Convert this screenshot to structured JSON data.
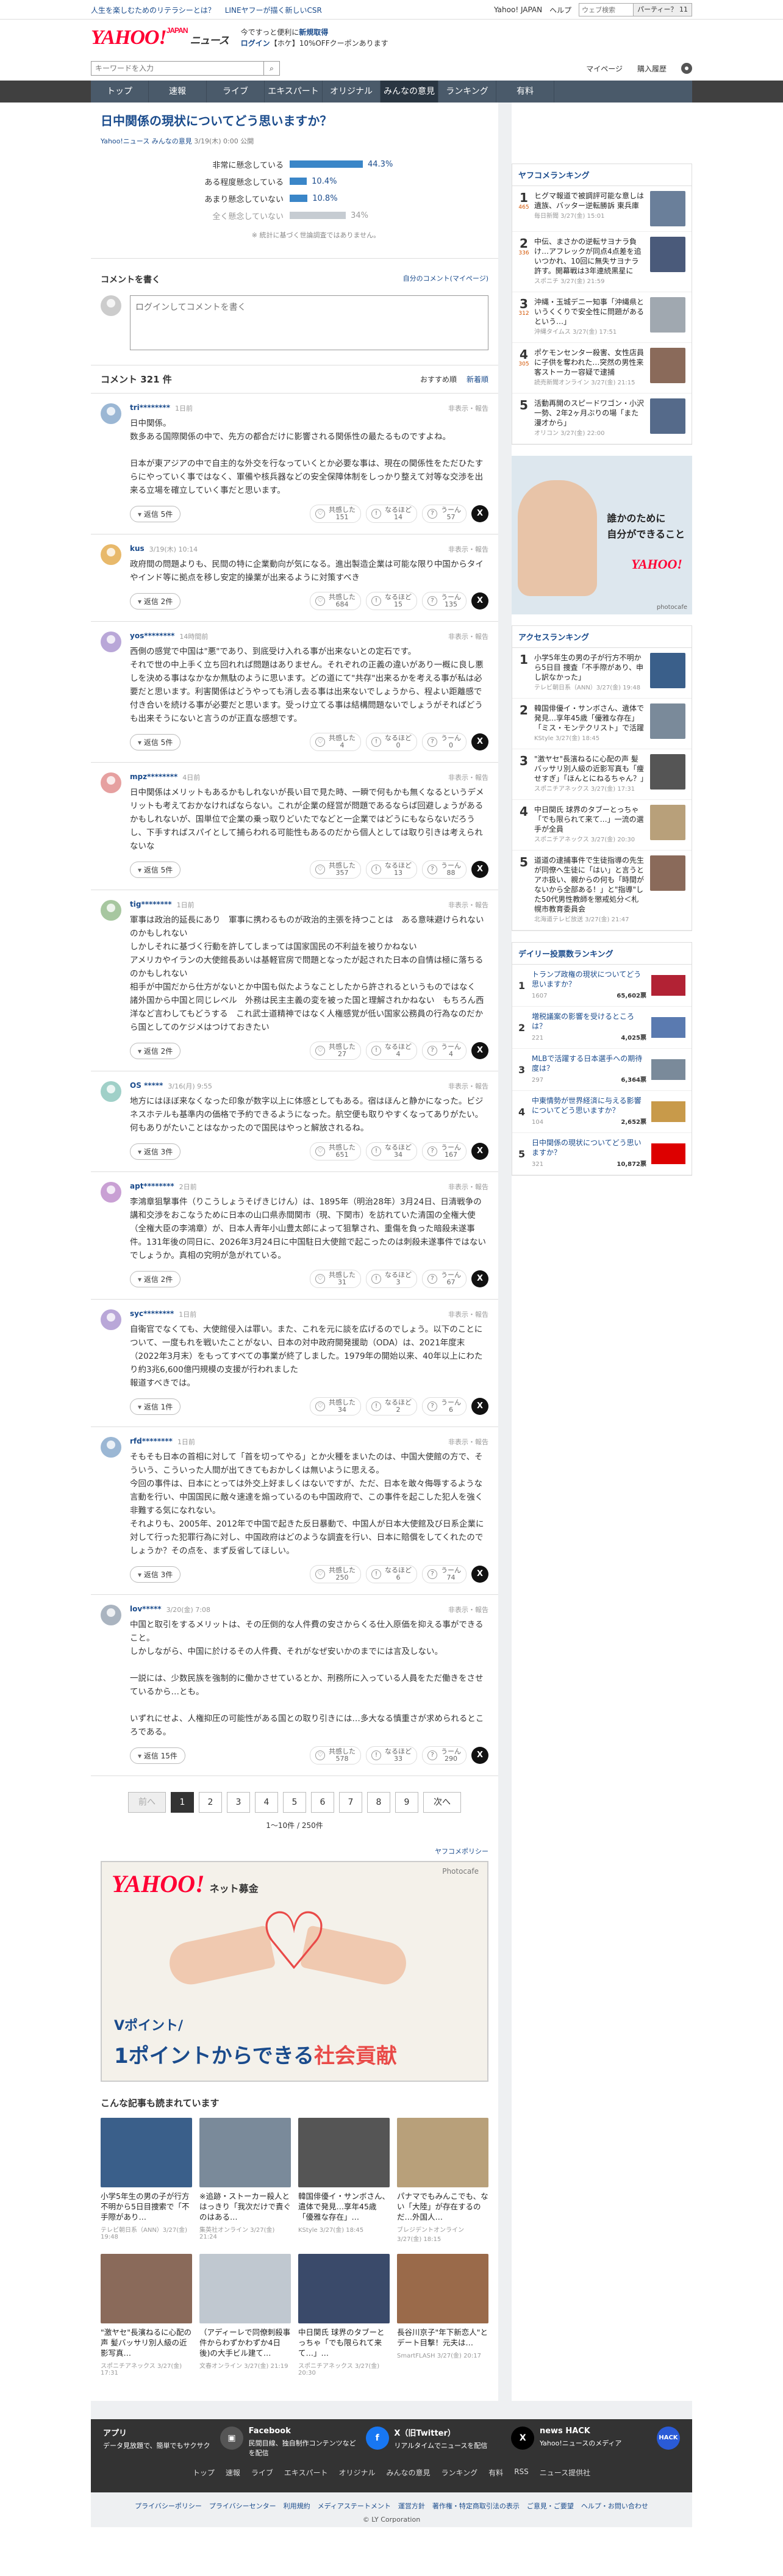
{
  "topbar": {
    "left1": "人生を楽しむためのリテラシーとは？",
    "left2": "LINEヤフーが描く新しいCSR",
    "right1": "Yahoo! JAPAN",
    "right2": "ヘルプ",
    "search_placeholder": "ウェブ検索",
    "search_btn": "パーティー？ 11"
  },
  "header": {
    "logo": "YAHOO!",
    "logo_sub": "JAPAN",
    "logo_news": "ニュース",
    "promo1": "今ですっと便利に",
    "promo1b": "新規取得",
    "promo2": "ログイン",
    "promo2b": "【ホケ】10%OFFクーポンあります"
  },
  "searchrow": {
    "placeholder": "キーワードを入力",
    "mypage": "マイページ",
    "purchase": "購入履歴"
  },
  "nav": [
    "トップ",
    "速報",
    "ライブ",
    "エキスパート",
    "オリジナル",
    "みんなの意見",
    "ランキング",
    "有料"
  ],
  "poll": {
    "title": "日中関係の現状についてどう思いますか？",
    "meta_src": "Yahoo!ニュース みんなの意見",
    "meta_date": "3/19(木) 0:00 公開",
    "options": [
      {
        "label": "非常に懸念している",
        "pct": "44.3%",
        "v": 44.3
      },
      {
        "label": "ある程度懸念している",
        "pct": "10.4%",
        "v": 10.4
      },
      {
        "label": "あまり懸念していない",
        "pct": "10.8%",
        "v": 10.8
      },
      {
        "label": "全く懸念していない",
        "pct": "34%",
        "v": 34
      }
    ],
    "note": "※ 統計に基づく世論調査ではありません。"
  },
  "cwrite": {
    "title": "コメントを書く",
    "link": "自分のコメント(マイページ)",
    "placeholder": "ログインしてコメントを書く"
  },
  "comments": {
    "title": "コメント 321 件",
    "sort1": "おすすめ順",
    "sort2": "新着順",
    "report": "非表示・報告",
    "items": [
      {
        "user": "tri********",
        "time": "1日前",
        "text": "日中関係。\n数多ある国際関係の中で、先方の都合だけに影響される関係性の最たるものですよね。\n\n日本が東アジアの中で自主的な外交を行なっていくとか必要な事は、現在の関係性をただひたすらにやっていく事ではなく、軍備や核兵器などの安全保障体制をしっかり整えて対等な交渉を出来る立場を確立していく事だと思います。",
        "reply": "返信 5件",
        "r1": "151",
        "r2": "14",
        "r3": "57"
      },
      {
        "user": "kus",
        "time": "3/19(木) 10:14",
        "text": "政府間の問題よりも、民間の特に企業動向が気になる。進出製造企業は可能な限り中国からタイやインド等に拠点を移し安定的操業が出来るように対策すべき",
        "reply": "返信 2件",
        "r1": "684",
        "r2": "15",
        "r3": "135"
      },
      {
        "user": "yos********",
        "time": "14時間前",
        "text": "西側の感覚で中国は\"悪\"であり、到底受け入れる事が出来ないとの定石です。\nそれで世の中上手く立ち回れれば問題はありません。それぞれの正義の違いがあり一概に良し悪しを決める事はなかなか無駄のように思います。どの道にて\"共存\"出来るかを考える事が私は必要だと思います。利害関係はどうやっても消し去る事は出来ないでしょうから、程よい距離感で付き合いを続ける事が必要だと思います。受っけ立てる事は結構問題ないでしょうがそればどうも出来そうにないと言うのが正直な感想です。",
        "reply": "返信 5件",
        "r1": "4",
        "r2": "0",
        "r3": "0"
      },
      {
        "user": "mpz********",
        "time": "4日前",
        "text": "日中関係はメリットもあるかもしれないが長い目で見た時、一瞬で何もかも無くなるというデメリットも考えておかなければならない。これが企業の経営が問題であるならば回避しょうがあるかもしれないが、国単位で企業の乗っ取りどいたでなどと一企業ではどうにもならないだろうし、下手すればスパイとして捕らわれる可能性もあるのだから個人としては取り引きは考えられないな",
        "reply": "返信 5件",
        "r1": "357",
        "r2": "13",
        "r3": "88"
      },
      {
        "user": "tig********",
        "time": "1日前",
        "text": "軍事は政治的延長にあり　軍事に携わるものが政治的主張を持つことは　ある意味避けられないのかもしれない\nしかしそれに基づく行動を許してしまっては国家国民の不利益を被りかねない\nアメリカやイランの大使館長あいは基軽官房で問題となったが起された日本の自情は極に落ちるのかもしれない\n相手が中国だから仕方がないとか中国も似たようなことしたから許されるというものではなく　諸外国から中国と同じレベル　外務は民主主義の変を被った国と理解されかねない　もちろん西洋など言わしてもどうする　これ武士道精神ではなく人権感覚が低い国家公務員の行為なのだから国としてのケジメはつけておきたい",
        "reply": "返信 2件",
        "r1": "27",
        "r2": "4",
        "r3": "4"
      },
      {
        "user": "OS *****",
        "time": "3/16(月) 9:55",
        "text": "地方にはほぼ来なくなった印象が数字以上に体感としてもある。宿はほんと静かになった。ビジネスホテルも基準内の価格で予約できるようになった。航空便も取りやすくなってありがたい。何もありがたいことはなかったので国民はやっと解放されるね。",
        "reply": "返信 3件",
        "r1": "651",
        "r2": "34",
        "r3": "167"
      },
      {
        "user": "apt********",
        "time": "2日前",
        "text": "李鴻章狙撃事件（りこうしょうそげきじけん）は、1895年（明治28年）3月24日、日清戦争の講和交渉をおこなうために日本の山口県赤間関市（現、下関市）を訪れていた清国の全権大使（全権大臣の李鴻章）が、日本人青年小山豊太郎によって狙撃され、重傷を負った暗殺未遂事件。131年後の同日に、2026年3月24日に中国駐日大使館で起こったのは刺殺未遂事件ではないでしょうか。真相の究明が急がれている。",
        "reply": "返信 2件",
        "r1": "31",
        "r2": "3",
        "r3": "67"
      },
      {
        "user": "syc********",
        "time": "1日前",
        "text": "自衛官でなくても、大使館侵入は罪い。また、これを元に談を広げるのでしょう。以下のことについて、一度もれを戦いたことがない、日本の対中政府開発援助（ODA）は、2021年度末（2022年3月末）をもってすべての事業が終了しました。1979年の開始以来、40年以上にわたり約3兆6,600億円規模の支援が行われました\n報道すべきでは。",
        "reply": "返信 1件",
        "r1": "34",
        "r2": "2",
        "r3": "6"
      },
      {
        "user": "rfd********",
        "time": "1日前",
        "text": "そもそも日本の首相に対して「首を切ってやる」とか火種をまいたのは、中国大使館の方で、そういう、こういった人間が出てきてもおかしくは無いように思える。\n今回の事件は、日本にとっては外交上好ましくはないですが、ただ、日本を敢々侮辱するような言動を行い、中国国民に敵々速達を煽っているのも中国政府で、この事件を起こした犯人を強く非難する気になれない。\nそれよりも、2005年、2012年で中国で起きた反日暴動で、中国人が日本大使館及び日系企業に対して行った犯罪行為に対し、中国政府はどのような調査を行い、日本に賠償をしてくれたのでしょうか？その点を、まず反省してほしい。",
        "reply": "返信 3件",
        "r1": "250",
        "r2": "6",
        "r3": "74"
      },
      {
        "user": "lov*****",
        "time": "3/20(金) 7:08",
        "text": "中国と取引をするメリットは、その圧倒的な人件費の安さからくる仕入原価を抑える事ができること。\nしかしながら、中国に於けるその人件費、それがなぜ安いかのまでには言及しない。\n\n一説には、少数民族を強制的に働かさせているとか、刑務所に入っている人員をただ働きをさせているから…とも。\n\nいずれにせよ、人権抑圧の可能性がある国との取り引きには…多大なる慎重さが求められるところである。",
        "reply": "返信 15件",
        "r1": "578",
        "r2": "33",
        "r3": "290"
      }
    ],
    "react": {
      "a": "共感した",
      "b": "なるほど",
      "c": "うーん"
    }
  },
  "pager": {
    "prev": "前へ",
    "next": "次へ",
    "pages": [
      "1",
      "2",
      "3",
      "4",
      "5",
      "6",
      "7",
      "8",
      "9"
    ],
    "count": "1〜10件 / 250件"
  },
  "policy": "ヤフコメポリシー",
  "banner": {
    "logo": "YAHOO!",
    "sub": "ネット募金",
    "photo": "Photocafe",
    "t1": "Vポイント/",
    "t2a": "1ポイント",
    "t2b": "からできる",
    "t2c": "社会貢献"
  },
  "alsoread": {
    "title": "こんな記事も読まれています",
    "items": [
      {
        "ttl": "小学5年生の男の子が行方不明から5日目捜索で「不手際があり…",
        "src": "テレビ朝日系（ANN）3/27(金) 19:48"
      },
      {
        "ttl": "※追跡・ストーカー殺人とはっきり「我次だけで責ぐのはある…",
        "src": "集英社オンライン 3/27(金) 21:24"
      },
      {
        "ttl": "韓国俳優イ・サンボさん、遺体で発見…享年45歳「優雅な存在」…",
        "src": "KStyle 3/27(金) 18:45"
      },
      {
        "ttl": "パナマでもみんこでも、ない「大陸」が存在するのだ…外国人…",
        "src": "ブレジデントオンライン 3/27(金) 18:15"
      },
      {
        "ttl": "\"激ヤセ\"長濱ねるに心配の声 髪バッサリ別人級の近影写真…",
        "src": "スポニチアネックス 3/27(金) 17:31"
      },
      {
        "ttl": "（アディーレで同僚刺殺事件からわずかわずか4日後)の大手ビル建て…",
        "src": "文春オンライン 3/27(金) 21:19"
      },
      {
        "ttl": "中日関氏 球界のタブーとっちゃ「でも限られて来て…」…",
        "src": "スポニチアネックス 3/27(金) 20:30"
      },
      {
        "ttl": "長谷川京子\"年下新恋人\"とデート目撃！元夫は…",
        "src": "SmartFLASH 3/27(金) 20:17"
      }
    ]
  },
  "right": {
    "rank1_title": "ヤフコメランキング",
    "rank1": [
      {
        "n": "1",
        "c": "465",
        "t": "ヒグマ報道で被調評可能な意しは遺族、バッター逆転勝訴 東兵庫",
        "s": "毎日新聞 3/27(金) 15:01"
      },
      {
        "n": "2",
        "c": "336",
        "t": "中伝、まさかの逆転サヨナラ負け…アフレックが同点4点差を追いつかれ、10回に無失サヨナラ許す。開幕戦は3年連続黒星に",
        "s": "スポニチ 3/27(金) 21:59"
      },
      {
        "n": "3",
        "c": "312",
        "t": "沖縄・玉城デニー知事「沖縄県というくくりで安全性に問題があるという…」",
        "s": "沖縄タイムス 3/27(金) 17:51"
      },
      {
        "n": "4",
        "c": "305",
        "t": "ポケモンセンター殺害、女性店員に子供を奪われた…突然の男性来客ストーカー容疑で逮捕",
        "s": "読売新聞オンライン 3/27(金) 21:15"
      },
      {
        "n": "5",
        "c": "",
        "t": "活動再開のスピードワゴン・小沢一勢、2年2ヶ月ぶりの場「また漫才から」",
        "s": "オリコン 3/27(金) 22:00"
      }
    ],
    "ad_text1": "誰かのために",
    "ad_text2": "自分ができること",
    "ad_logo": "YAHOO!",
    "ad_photo": "photocafe",
    "rank2_title": "アクセスランキング",
    "rank2": [
      {
        "n": "1",
        "t": "小学5年生の男の子が行方不明から5日目 捜査「不手際があり、申し訳なかった」",
        "s": "テレビ朝日系（ANN）3/27(金) 19:48"
      },
      {
        "n": "2",
        "t": "韓国俳優イ・サンボさん、遺体で発見…享年45歳「優雅な存在」「ミス・モンテクリスト」で活躍",
        "s": "KStyle 3/27(金) 18:45"
      },
      {
        "n": "3",
        "t": "\"激ヤセ\"長濱ねるに心配の声 髪バッサリ別人級の近影写真も「痩せすぎ」「ほんとにねるちゃん？」",
        "s": "スポニチアネックス 3/27(金) 17:31"
      },
      {
        "n": "4",
        "t": "中日関氏 球界のタブーとっちゃ「でも限られて来て…」一流の選手が全員",
        "s": "スポニチアネックス 3/27(金) 20:30"
      },
      {
        "n": "5",
        "t": "道道の逮捕事件で生徒指導の先生が同僚へ生徒に「はい」と言うとアホ扱い、親からの何も「時間がないから全部ある！」と\"指導\"した50代男性教師を懲戒処分＜札幌市教育委員会",
        "s": "北海道テレビ放送 3/27(金) 21:47"
      }
    ],
    "rank3_title": "デイリー投票数ランキング",
    "rank3": [
      {
        "n": "1",
        "t": "トランプ政権の現状についてどう思いますか？",
        "c": "1607",
        "v": "65,602票"
      },
      {
        "n": "2",
        "t": "増税議案の影響を受けるところは？",
        "c": "221",
        "v": "4,025票"
      },
      {
        "n": "3",
        "t": "MLBで活躍する日本選手への期待度は？",
        "c": "297",
        "v": "6,364票"
      },
      {
        "n": "4",
        "t": "中東情勢が世界経済に与える影響についてどう思いますか？",
        "c": "104",
        "v": "2,652票"
      },
      {
        "n": "5",
        "t": "日中関係の現状についてどう思いますか？",
        "c": "321",
        "v": "10,872票"
      }
    ]
  },
  "footer": {
    "s1t": "アプリ",
    "s1d": "データ見放題で、簡単でもサクサク",
    "s2t": "Facebook",
    "s2d": "民間目線、独自制作コンテンツなどを配信",
    "s3t": "X（旧Twitter）",
    "s3d": "リアルタイムでニュースを配信",
    "s4t": "news HACK",
    "s4d": "Yahoo!ニュースのメディア",
    "links": [
      "トップ",
      "速報",
      "ライブ",
      "エキスパート",
      "オリジナル",
      "みんなの意見",
      "ランキング",
      "有料",
      "RSS",
      "ニュース提供社"
    ],
    "bottom": [
      "プライバシーポリシー",
      "プライバシーセンター",
      "利用規約",
      "メディアステートメント",
      "運営方針",
      "著作権・特定商取引法の表示",
      "ご意見・ご要望",
      "ヘルプ・お問い合わせ"
    ],
    "copy": "© LY Corporation"
  },
  "colors": {
    "accent": "#1a4b8c",
    "brand": "#ff0033",
    "bar": "#3a86c8"
  }
}
